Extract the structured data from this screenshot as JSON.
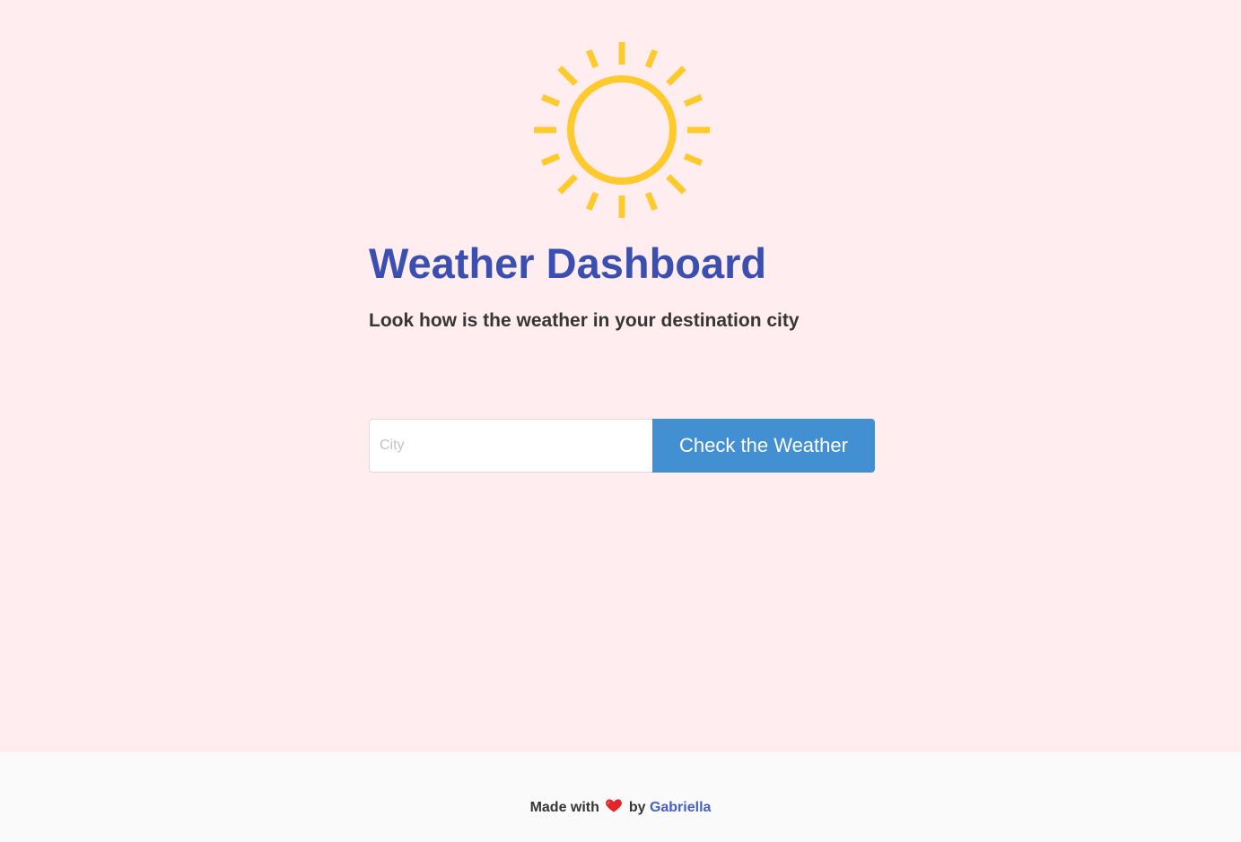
{
  "page": {
    "title": "Weather Dashboard",
    "subtitle": "Look how is the weather in your destination city"
  },
  "hero": {
    "icon": "sun-icon",
    "icon_color": "#ffca2d"
  },
  "search": {
    "placeholder": "City",
    "value": "",
    "button_label": "Check the Weather"
  },
  "footer": {
    "prefix": "Made with",
    "heart_icon": "heart-icon",
    "by": "by",
    "author": "Gabriella"
  },
  "colors": {
    "background": "#ffedf0",
    "footer_background": "#fafafa",
    "title": "#3b4fb0",
    "button": "#428fd1",
    "link": "#485fc7"
  }
}
